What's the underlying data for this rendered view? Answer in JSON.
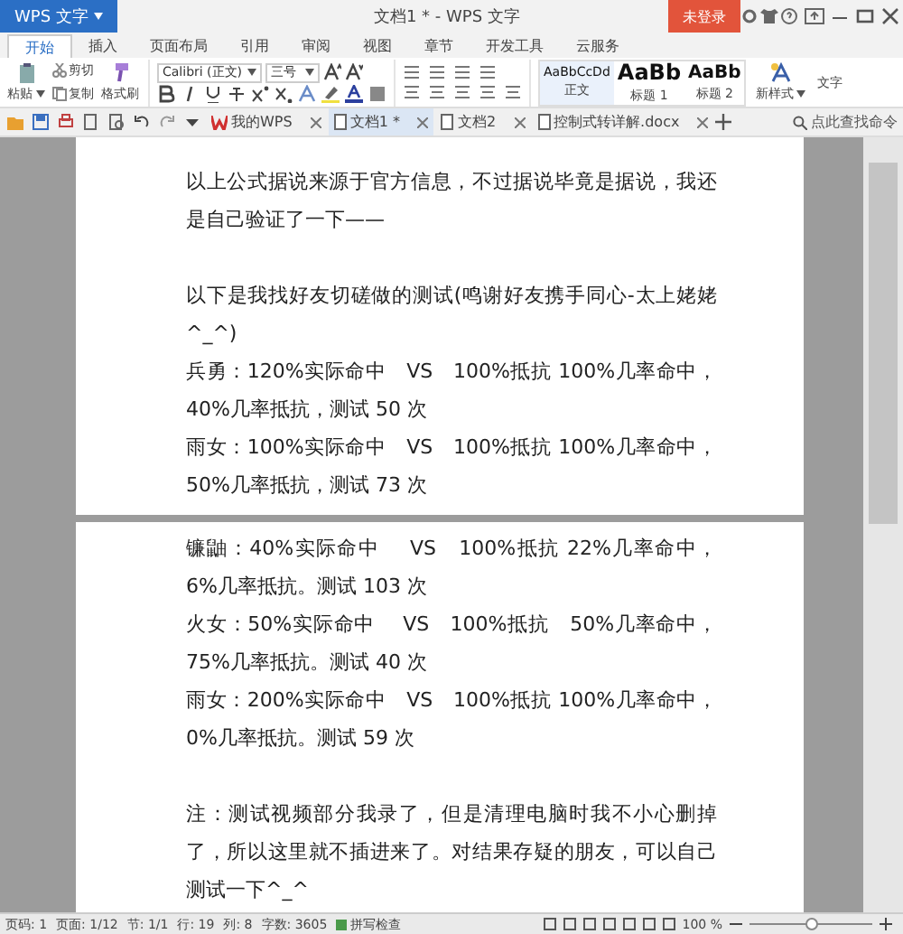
{
  "title_bar": {
    "app_button": "WPS 文字",
    "title": "文档1 * - WPS 文字",
    "login_button": "未登录"
  },
  "ribbon_tabs": [
    {
      "label": "开始",
      "selected": true
    },
    {
      "label": "插入",
      "selected": false
    },
    {
      "label": "页面布局",
      "selected": false
    },
    {
      "label": "引用",
      "selected": false
    },
    {
      "label": "审阅",
      "selected": false
    },
    {
      "label": "视图",
      "selected": false
    },
    {
      "label": "章节",
      "selected": false
    },
    {
      "label": "开发工具",
      "selected": false
    },
    {
      "label": "云服务",
      "selected": false
    }
  ],
  "ribbon": {
    "paste": "粘贴",
    "cut": "剪切",
    "copy": "复制",
    "format_painter": "格式刷",
    "font": "Calibri (正文)",
    "size": "三号",
    "styles": [
      {
        "preview": "AaBbCcDd",
        "label": "正文",
        "kind": "body"
      },
      {
        "preview": "AaBb",
        "label": "标题 1",
        "kind": "heading1"
      },
      {
        "preview": "AaBb",
        "label": "标题 2",
        "kind": "heading2"
      }
    ],
    "new_style": "新样式",
    "overflow": "文字"
  },
  "doc_tabs": [
    {
      "label": "我的WPS",
      "selected": false,
      "kind": "home"
    },
    {
      "label": "文档1 *",
      "selected": true,
      "kind": "doc"
    },
    {
      "label": "文档2",
      "selected": false,
      "kind": "doc"
    },
    {
      "label": "控制式转详解.docx",
      "selected": false,
      "kind": "doc"
    }
  ],
  "search": {
    "placeholder": "点此查找命令"
  },
  "pages": [
    {
      "blocks": [
        [
          "以上公式据说来源于官方信息，不过据说毕竟是据说，我还是自己验证了一下——"
        ],
        [
          "以下是我找好友切磋做的测试(鸣谢好友携手同心-太上姥姥^_^)",
          "兵勇：120%实际命中   VS   100%抵抗 100%几率命中，40%几率抵抗，测试 50 次",
          "雨女：100%实际命中   VS   100%抵抗 100%几率命中，50%几率抵抗，测试 73 次"
        ]
      ]
    },
    {
      "blocks": [
        [
          "镰鼬：40%实际命中    VS   100%抵抗 22%几率命中，6%几率抵抗。测试 103 次",
          "火女：50%实际命中    VS   100%抵抗   50%几率命中，75%几率抵抗。测试 40 次",
          "雨女：200%实际命中   VS   100%抵抗 100%几率命中，0%几率抵抗。测试 59 次"
        ],
        [
          "注：测试视频部分我录了，但是清理电脑时我不小心删掉了，所以这里就不插进来了。对结果存疑的朋友，可以自己测试一下^_^"
        ]
      ]
    }
  ],
  "status_bar": {
    "items": [
      "页码: 1",
      "页面: 1/12",
      "节: 1/1",
      "行: 19",
      "列: 8",
      "字数: 3605"
    ],
    "spell_check": "拼写检查",
    "zoom": "100 %",
    "zoom_slider": {
      "level": 0.5
    }
  }
}
